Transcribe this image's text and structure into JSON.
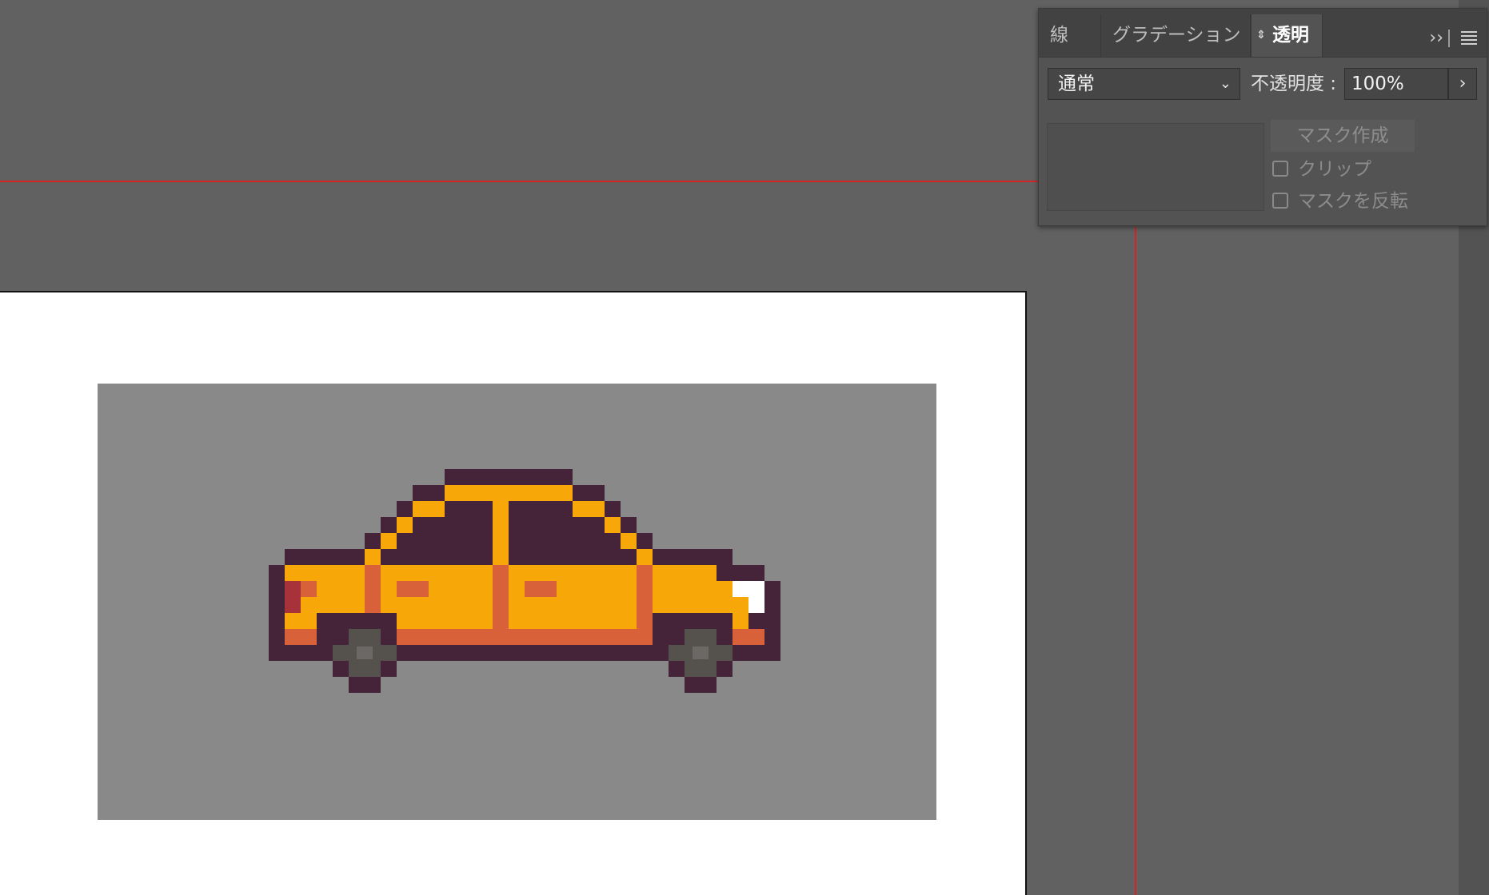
{
  "panel": {
    "tabs": [
      {
        "label": "線",
        "active": false
      },
      {
        "label": "グラデーション",
        "active": false
      },
      {
        "label": "透明",
        "active": true
      }
    ],
    "expand_icon": "double-chevron-right-icon",
    "menu_icon": "hamburger-menu-icon",
    "blend_mode": "通常",
    "opacity_label": "不透明度 :",
    "opacity_value": "100%",
    "mask_button_label": "マスク作成",
    "clip_label": "クリップ",
    "invert_mask_label": "マスクを反転",
    "clip_checked": false,
    "invert_checked": false
  },
  "canvas": {
    "artboard_color": "#ffffff",
    "background_rect_color": "#898989",
    "guide_color": "#d42424"
  },
  "artwork": {
    "subject": "pixel-art taxi car",
    "colors": {
      "outline": "#45243a",
      "body": "#f7a808",
      "trim": "#d9613a",
      "taillight": "#a8323a",
      "headlight": "#ffffff",
      "wheel": "#55524e"
    }
  }
}
